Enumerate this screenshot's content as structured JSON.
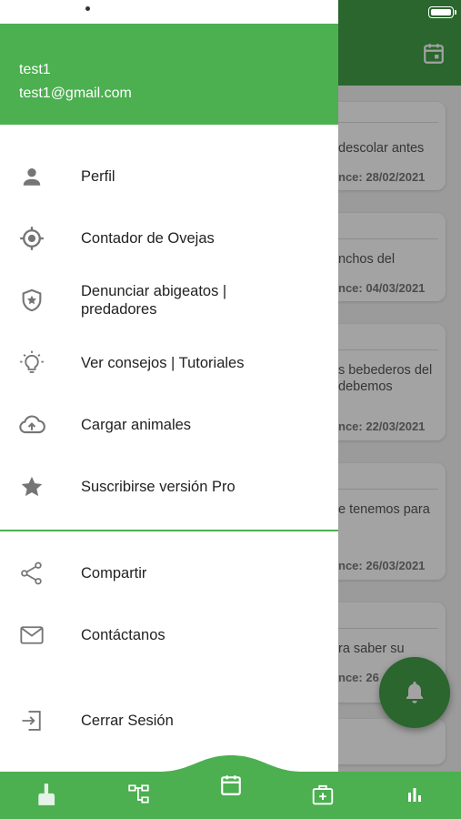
{
  "user": {
    "name": "test1",
    "email": "test1@gmail.com"
  },
  "menu": [
    {
      "label": "Perfil",
      "icon": "person-icon"
    },
    {
      "label": "Contador de Ovejas",
      "icon": "target-icon"
    },
    {
      "label": "Denunciar abigeatos |\npredadores",
      "icon": "shield-star-icon"
    },
    {
      "label": "Ver consejos | Tutoriales",
      "icon": "lightbulb-icon"
    },
    {
      "label": "Cargar animales",
      "icon": "cloud-upload-icon"
    },
    {
      "label": "Suscribirse versión Pro",
      "icon": "star-icon"
    }
  ],
  "menu_secondary": [
    {
      "label": "Compartir",
      "icon": "share-icon"
    },
    {
      "label": "Contáctanos",
      "icon": "mail-icon"
    },
    {
      "label": "Cerrar Sesión",
      "icon": "logout-icon"
    }
  ],
  "background_cards": [
    {
      "text": "descolar antes",
      "due": "nce: 28/02/2021"
    },
    {
      "text": "nchos del",
      "due": "nce: 04/03/2021"
    },
    {
      "text": "s bebederos del\ndebemos",
      "due": "nce: 22/03/2021"
    },
    {
      "text": "e tenemos para",
      "due": "nce: 26/03/2021"
    },
    {
      "text": "ra saber su",
      "due": "nce: 26"
    }
  ],
  "bottom_nav": [
    "sheep-icon",
    "hierarchy-icon",
    "calendar-icon",
    "medical-kit-icon",
    "bar-chart-icon"
  ],
  "colors": {
    "primary": "#4caf50",
    "primary_dark": "#43a047",
    "text": "#222222",
    "icon": "#757575"
  }
}
